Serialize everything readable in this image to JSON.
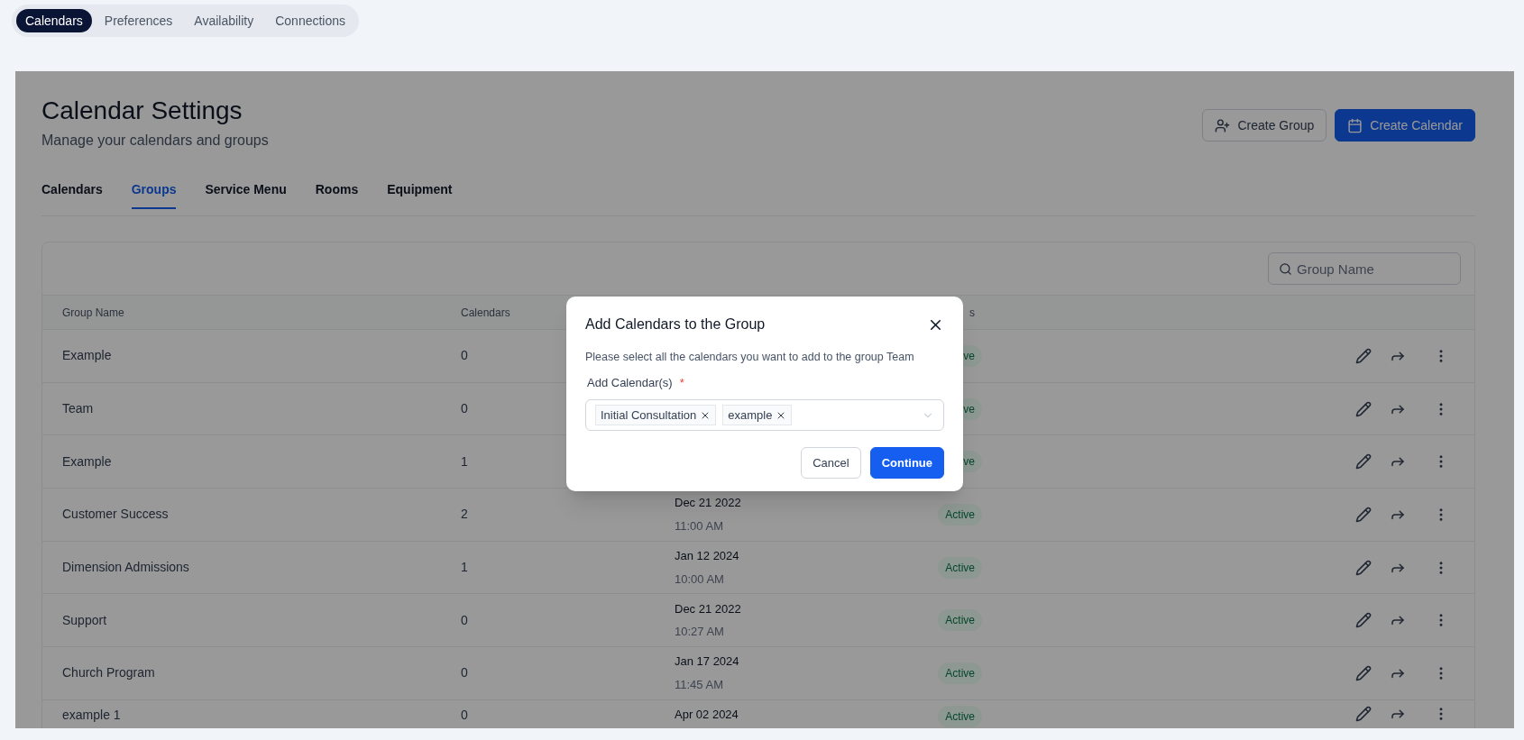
{
  "top_nav": [
    {
      "label": "Calendars",
      "selected": true
    },
    {
      "label": "Preferences",
      "selected": false
    },
    {
      "label": "Availability",
      "selected": false
    },
    {
      "label": "Connections",
      "selected": false
    }
  ],
  "header": {
    "title": "Calendar Settings",
    "subtitle": "Manage your calendars and groups"
  },
  "actions": [
    {
      "label": "Create Group",
      "kind": "secondary"
    },
    {
      "label": "Create Calendar",
      "kind": "primary"
    }
  ],
  "tabs": [
    {
      "label": "Calendars",
      "selected": false
    },
    {
      "label": "Groups",
      "selected": true
    },
    {
      "label": "Service Menu",
      "selected": false
    },
    {
      "label": "Rooms",
      "selected": false
    },
    {
      "label": "Equipment",
      "selected": false
    }
  ],
  "search": {
    "placeholder": "Group Name"
  },
  "table": {
    "column_headers": {
      "group_name": "Group Name",
      "calendars": "Calendars",
      "column_4": "s"
    },
    "rows": [
      {
        "name": "Example",
        "calendars": "0",
        "status": "ve"
      },
      {
        "name": "Team",
        "calendars": "0",
        "status": "ve"
      },
      {
        "name": "Example",
        "calendars": "1",
        "status": "ve"
      },
      {
        "name": "Customer Success",
        "calendars": "2",
        "date": "Dec 21 2022",
        "time": "11:00 AM",
        "status": "Active"
      },
      {
        "name": "Dimension Admissions",
        "calendars": "1",
        "date": "Jan 12 2024",
        "time": "10:00 AM",
        "status": "Active"
      },
      {
        "name": "Support",
        "calendars": "0",
        "date": "Dec 21 2022",
        "time": "10:27 AM",
        "status": "Active"
      },
      {
        "name": "Church Program",
        "calendars": "0",
        "date": "Jan 17 2024",
        "time": "11:45 AM",
        "status": "Active"
      },
      {
        "name": "example 1",
        "calendars": "0",
        "date": "Apr 02 2024",
        "status": "Active"
      }
    ]
  },
  "modal": {
    "title": "Add Calendars to the Group",
    "description": "Please select all the calendars you want to add to the group Team",
    "field_label": "Add Calendar(s)",
    "required_mark": "*",
    "tags": [
      "Initial Consultation",
      "example"
    ],
    "buttons": [
      {
        "label": "Cancel",
        "kind": "secondary"
      },
      {
        "label": "Continue",
        "kind": "primary"
      }
    ]
  }
}
